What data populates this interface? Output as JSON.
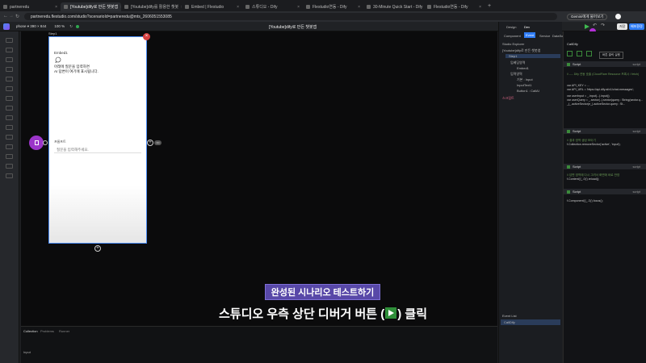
{
  "browser": {
    "tabs": [
      {
        "label": "partneredu"
      },
      {
        "label": "[Youtube]dify로 만든 챗봇앱"
      },
      {
        "label": "[Youtube]dify를 활용한 챗봇"
      },
      {
        "label": "Embed | Flestudio"
      },
      {
        "label": "스튜디오 - Dify"
      },
      {
        "label": "Flestudio연동 - Dify"
      },
      {
        "label": "30-Minute Quick Start - Dify"
      },
      {
        "label": "Flestudio연동 - Dify"
      }
    ],
    "url": "partneredu.flestudio.com/studio?scenarioId=partneredu@mts_2606051553085",
    "gemini_label": "Gemini에게 물어보기"
  },
  "app": {
    "device_label": "phone ▾ 390 × 844",
    "zoom_label": "100 %",
    "title": "[Youtube]dify로 만든 챗봇앱",
    "right_buttons": [
      "저장",
      "배포환경"
    ]
  },
  "phone": {
    "step_label": "Step1",
    "embed_label": "Embed1",
    "prompt_line1": "아래에 질문을 입력하면",
    "prompt_line2": "AI 답변이 여기에 표시됩니다.",
    "input_section_label": "프롬프트",
    "input_placeholder": "질문을 입력해주세요."
  },
  "bottom_panel": {
    "tabs": [
      "Collection",
      "Problems",
      "Runner"
    ],
    "item_label": "Input"
  },
  "right_panel": {
    "top_tabs": [
      "Design",
      "Dev"
    ],
    "sub_tabs": [
      "Component",
      "Event",
      "Service",
      "DataSource",
      "Etc"
    ],
    "explorer_title": "Studio Explorer",
    "root_label": "[Youtube]dify로 만든 챗봇앱",
    "tree": [
      {
        "label": "Step1"
      },
      {
        "label": "임베딩영역"
      },
      {
        "label": "Embed1"
      },
      {
        "label": "입력영역"
      },
      {
        "label": "기본 : Input"
      },
      {
        "label": "InputText1"
      },
      {
        "label": "Button1 : CallAI"
      },
      {
        "label": "스크립트"
      }
    ],
    "event_list_title": "Event List",
    "event_item": "CallDify"
  },
  "code_panel": {
    "title": "CallDify",
    "trigger_label": "버튼 클릭 실행",
    "scripts": [
      {
        "header": "Script",
        "toggle": "script",
        "lines": [
          "// ---- Dify 연동 호출 (CloudFlare Resource 프록시 / fetch)",
          "var API_KEY = ...",
          "var API_URL = 'https://api.dify.ai/v1/chat-messages';",
          "var userInput = _.input(...).input();",
          "var userQuery = _.sector(..).sector(query : String(sector.q...",
          "        _(_.activeSector(e_).activeSector.query : St..."
        ]
      },
      {
        "header": "Script",
        "toggle": "script",
        "lines": [
          "// 결과 영역 생성 보이기",
          "f.Collection.removeSector('active', 'input');"
        ]
      },
      {
        "header": "Script",
        "toggle": "script",
        "lines": [
          "// 답변 영역에 다시 그려서 화면에 바로 반영",
          "f.Content('(_.0)').reload();"
        ]
      },
      {
        "header": "Script",
        "toggle": "script",
        "lines": [
          "f.Component('(_.3)').focus();"
        ]
      }
    ]
  },
  "captions": {
    "line1": "완성된 시나리오 테스트하기",
    "line2_prefix": "스튜디오 우측 상단 디버거 버튼 (",
    "line2_suffix": ") 클릭"
  }
}
